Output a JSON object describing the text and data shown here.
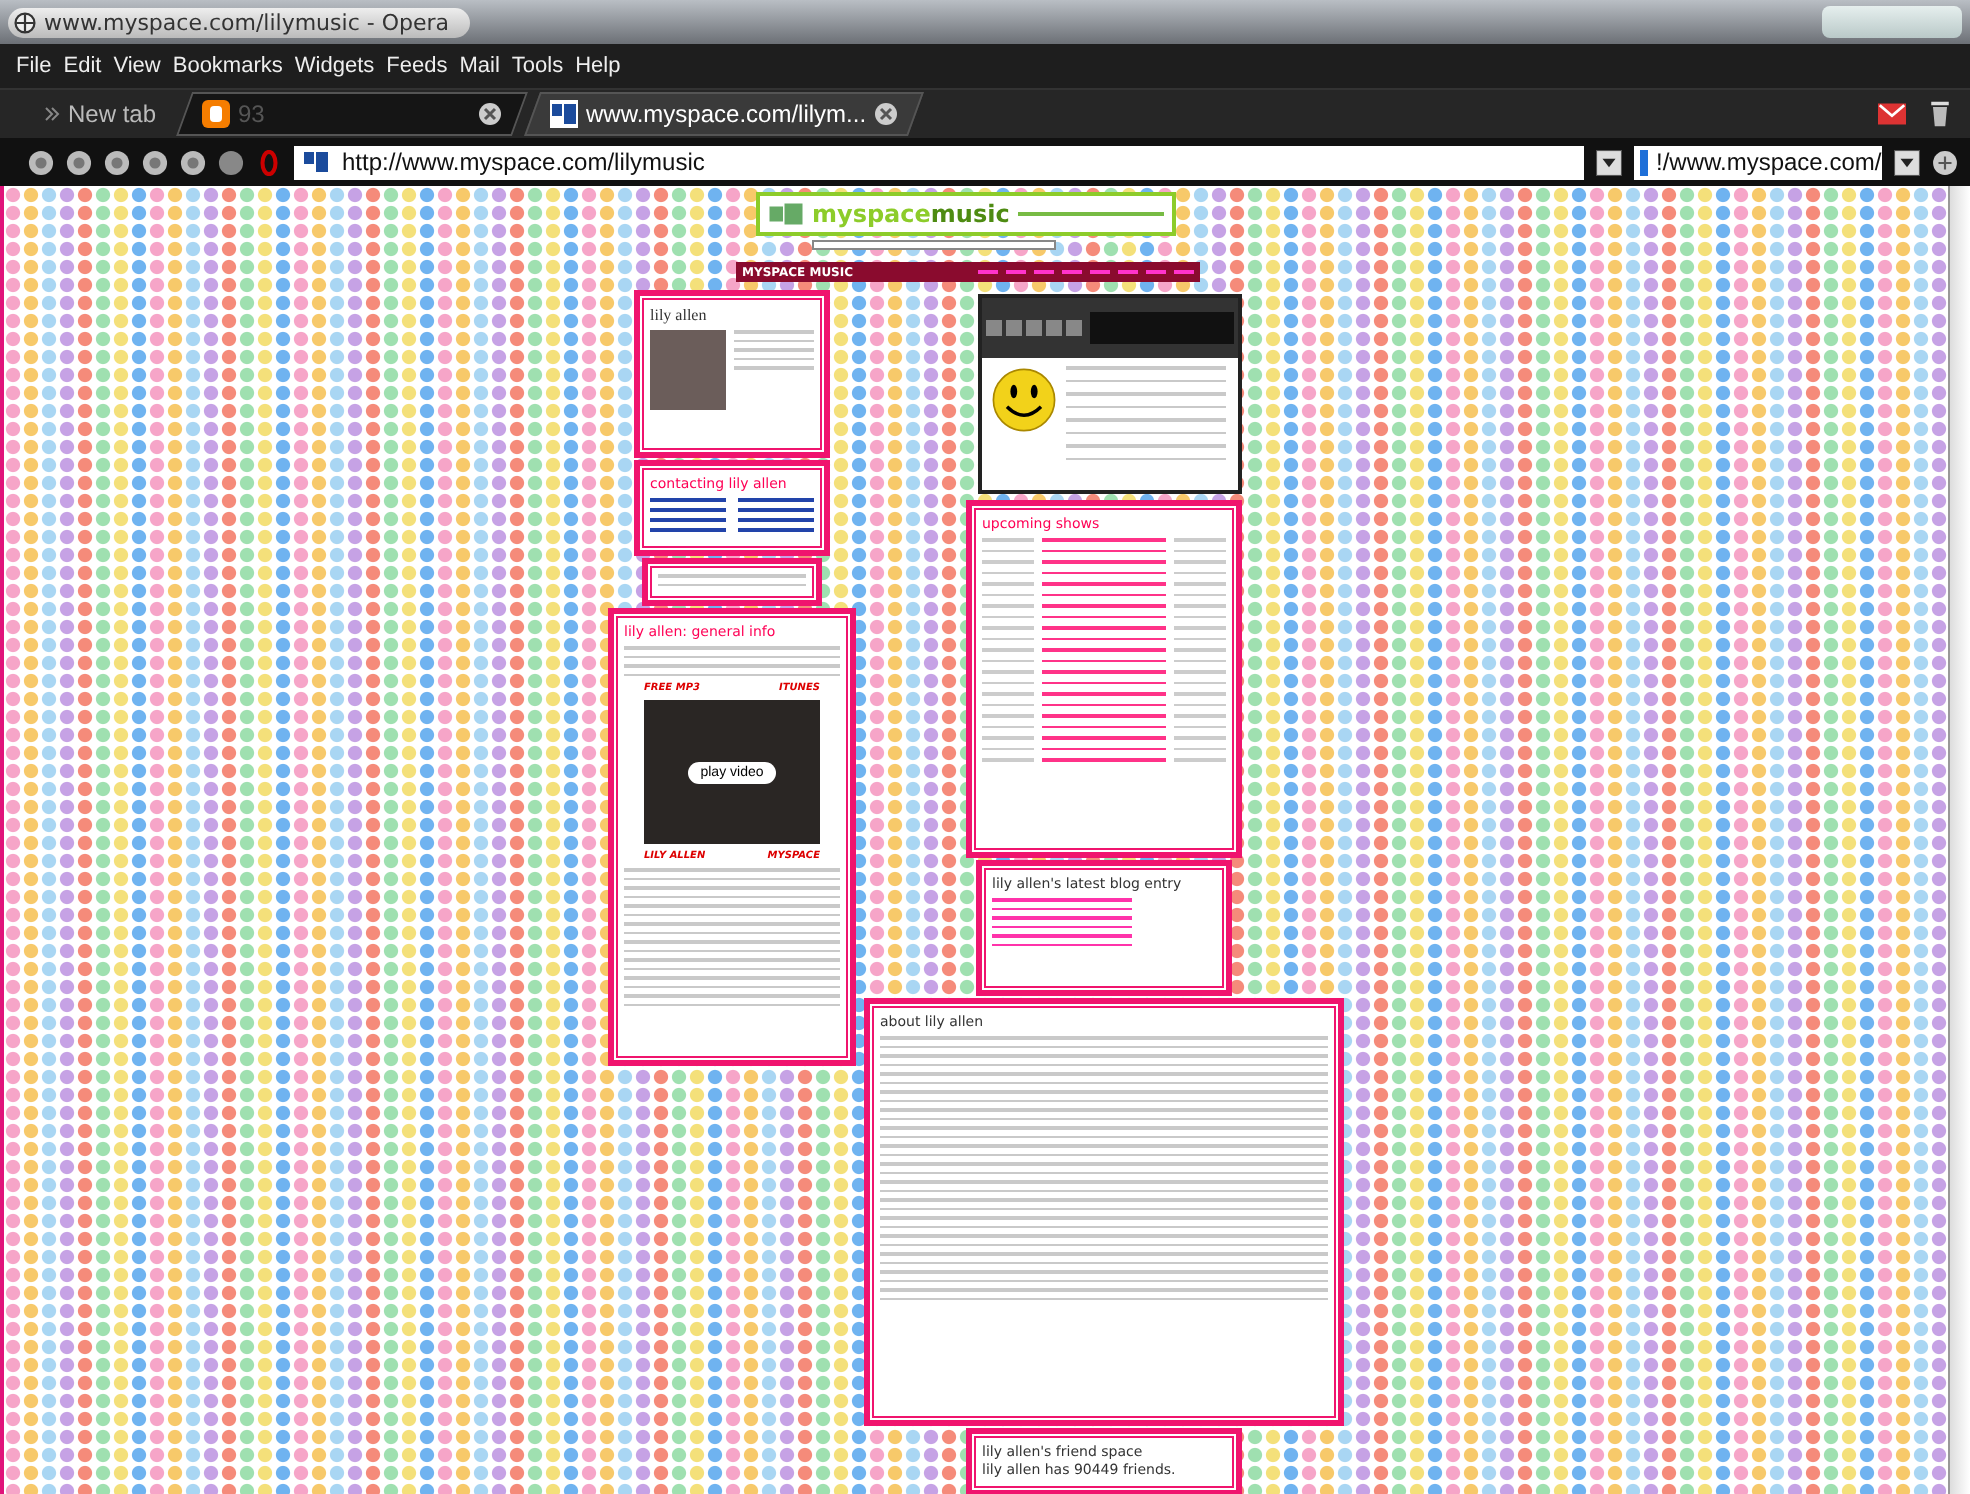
{
  "window": {
    "title": "www.myspace.com/lilymusic - Opera"
  },
  "menu": [
    "File",
    "Edit",
    "View",
    "Bookmarks",
    "Widgets",
    "Feeds",
    "Mail",
    "Tools",
    "Help"
  ],
  "tabs": [
    {
      "label": "New tab",
      "selected": false,
      "kind": "new"
    },
    {
      "label": "93",
      "selected": false,
      "kind": "blog"
    },
    {
      "label": "www.myspace.com/lilym...",
      "selected": true,
      "kind": "site"
    }
  ],
  "address_bar": {
    "url": "http://www.myspace.com/lilymusic"
  },
  "search": {
    "value": "!/www.myspace.com/"
  },
  "page": {
    "banner": {
      "brand": "myspace",
      "suffix": "music"
    },
    "nav_title": "MYSPACE MUSIC",
    "profile": {
      "name": "lily allen"
    },
    "contact": {
      "heading": "contacting lily allen"
    },
    "info": {
      "heading": "lily allen: general info",
      "video_labels": [
        "FREE MP3",
        "ITUNES",
        "LILY ALLEN",
        "MYSPACE"
      ],
      "play": "play video"
    },
    "shows": {
      "heading": "upcoming shows"
    },
    "blog": {
      "heading": "lily allen's latest blog entry"
    },
    "about": {
      "heading": "about lily allen"
    },
    "friends": {
      "heading": "lily allen's friend space",
      "count": "lily allen has 90449 friends."
    }
  }
}
